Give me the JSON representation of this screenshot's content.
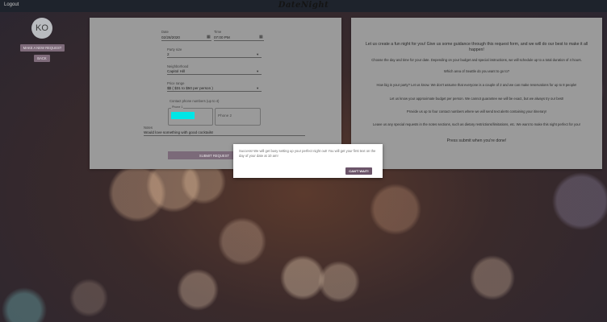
{
  "topbar": {
    "logout": "Logout",
    "brand": "DateNight"
  },
  "sidebar": {
    "avatar": "KO",
    "make_request": "MAKE A NEW REQUEST",
    "back": "BACK"
  },
  "form": {
    "date_label": "Date",
    "date_value": "02/28/2020",
    "time_label": "Time",
    "time_value": "07:00 PM",
    "party_label": "Party size",
    "party_value": "2",
    "neighborhood_label": "Neighborhood",
    "neighborhood_value": "Capitol Hill",
    "price_label": "Price range",
    "price_value": "$$ ( $31 to $50 per person )",
    "contact_label": "Contact phone numbers (up to 4)",
    "phone1_label": "Phone 1",
    "phone2_label": "Phone 2",
    "notes_label": "Notes",
    "notes_value": "Would love something with good cocktails!",
    "submit": "SUBMIT REQUEST"
  },
  "info": {
    "intro": "Let us create a fun night for you! Give us some guidance through this request form, and we will do our best to make it all happen!",
    "p1": "Choose the day and time for your date. Depending on your budget and special instructions, we will schedule up to a total duration of 4 hours.",
    "p2": "Which area of Seattle do you want to go to?",
    "p3": "How big is your party? Let us know. We don't assume that everyone is a couple of 2 and we can make reservations for up to 8 people!",
    "p4": "Let us know your approximate budget per person. We cannot guarantee we will be exact, but we always try our best!",
    "p5": "Provide us up to four contact numbers where we will send text alerts containing your itinerary!",
    "p6": "Leave us any special requests in the notes sections, such as dietary restrictions/limitations, etc. We want to make this night perfect for you!",
    "closing": "Press submit when you're done!"
  },
  "modal": {
    "message": "Success! We will get busy setting up your perfect night out! You will get your first text on the day of your date at 10 am!",
    "button": "CAN'T WAIT!"
  },
  "colors": {
    "accent": "#6b5469",
    "phone_fill": "#00e6e6",
    "panel": "#9a9a9a"
  }
}
